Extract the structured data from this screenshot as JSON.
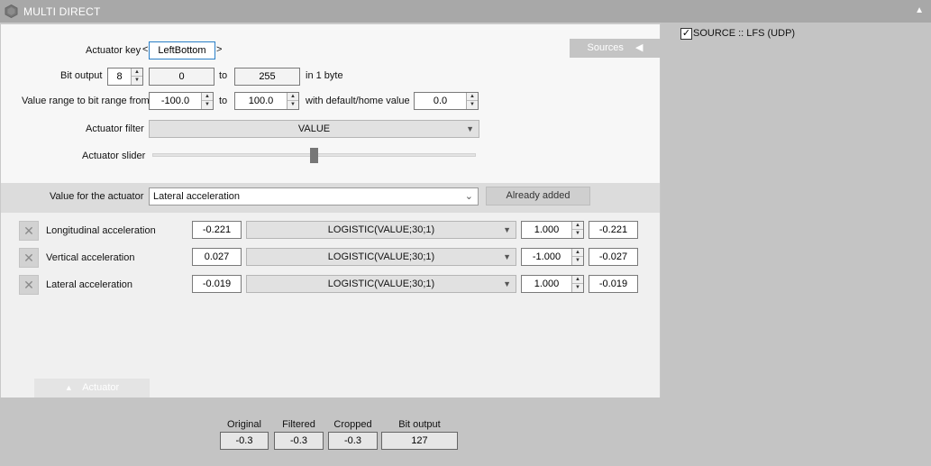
{
  "window": {
    "title": "MULTI DIRECT",
    "collapse_icon": "triangle-up-icon"
  },
  "actuator_key": {
    "label": "Actuator key",
    "prev": "<",
    "value": "LeftBottom",
    "next": ">"
  },
  "bit_output": {
    "label": "Bit output",
    "bits": "8",
    "min": "0",
    "to": "to",
    "max": "255",
    "suffix": "in 1 byte"
  },
  "value_range": {
    "label": "Value range to bit range from",
    "from": "-100.0",
    "to_label": "to",
    "to": "100.0",
    "default_label": "with default/home value",
    "default": "0.0"
  },
  "actuator_filter": {
    "label": "Actuator filter",
    "value": "VALUE"
  },
  "actuator_slider": {
    "label": "Actuator slider",
    "position": 0.5
  },
  "sources_tab": {
    "label": "Sources",
    "icon": "triangle-left-icon"
  },
  "value_for_actuator": {
    "label": "Value for the actuator",
    "selected": "Lateral acceleration",
    "button": "Already added"
  },
  "inputs": [
    {
      "name": "Longitudinal acceleration",
      "value": "-0.221",
      "filter": "LOGISTIC(VALUE;30;1)",
      "factor": "1.000",
      "result": "-0.221"
    },
    {
      "name": "Vertical acceleration",
      "value": "0.027",
      "filter": "LOGISTIC(VALUE;30;1)",
      "factor": "-1.000",
      "result": "-0.027"
    },
    {
      "name": "Lateral acceleration",
      "value": "-0.019",
      "filter": "LOGISTIC(VALUE;30;1)",
      "factor": "1.000",
      "result": "-0.019"
    }
  ],
  "actuator_tab": {
    "label": "Actuator",
    "icon": "triangle-up-icon"
  },
  "summary": {
    "original_label": "Original",
    "original": "-0.3",
    "filtered_label": "Filtered",
    "filtered": "-0.3",
    "cropped_label": "Cropped",
    "cropped": "-0.3",
    "bit_output_label": "Bit output",
    "bit_output": "127"
  },
  "source": {
    "label": "SOURCE :: LFS (UDP)",
    "checked": true
  }
}
